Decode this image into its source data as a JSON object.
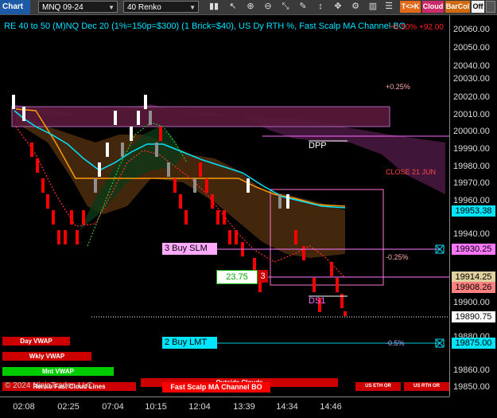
{
  "toolbar": {
    "chart_tab": "Chart",
    "instrument": "MNQ 09-24",
    "bar_type": "40 Renko",
    "tk_label": "T<>K",
    "cloud_label": "Cloud",
    "barcol_label": "BarCol",
    "off_label": "Off",
    "icons": [
      "bars-icon",
      "cursor-icon",
      "zoom-in-icon",
      "zoom-out-icon",
      "pointer-icon",
      "text-icon",
      "scale-icon",
      "pan-icon",
      "strategy-icon",
      "columns-icon",
      "list-icon",
      "share-icon"
    ]
  },
  "header": {
    "title": "RE 40 to 50 (M)NQ Dec 20 (1%=150p=$300) (1 Brick=$40), US Dy RTH %, Fast Scalp MA Channel BO",
    "top_right_value": "+0.50%  +92.00"
  },
  "annotations": {
    "pct_plus_025": "+0.25%",
    "dpp": "DPP",
    "close_label": "CLOSE 21 JUN",
    "pct_minus_025": "-0.25%",
    "pct_minus_05": "-0.5%",
    "ds1": "DS1",
    "buy_slm": "3 Buy SLM",
    "buy_lmt": "2 Buy LMT",
    "qty_value": "23.75",
    "qty_count": "3",
    "copyright": "© 2024 NinjaTrader, LLC",
    "fast_scalp": "Fast Scalp MA Channel BO",
    "outside_clouds": "Outside Clouds",
    "renko_label": "Renko Fast Cloud Lines"
  },
  "buttons": {
    "day_vwap": "Day VWAP",
    "wkly_vwap": "Wkly VWAP",
    "mnt_vwap": "Mnt VWAP",
    "us_eth_or": "US ETH OR",
    "us_rth_or": "US RTH OR"
  },
  "yaxis": {
    "labels": [
      "20060.00",
      "20050.00",
      "20040.00",
      "20030.00",
      "20020.00",
      "20010.00",
      "20000.00",
      "19990.00",
      "19980.00",
      "19970.00",
      "19960.00",
      "19940.00",
      "19900.00",
      "19880.00",
      "19860.00",
      "19850.00"
    ],
    "markers": {
      "price_top": "19953.38",
      "buy_slm": "19930.25",
      "gray": "19914.25",
      "last": "19908.26",
      "current": "19890.75",
      "buy_lmt": "19875.00"
    }
  },
  "xaxis": {
    "labels": [
      "02:08",
      "02:25",
      "07:04",
      "10:15",
      "12:04",
      "13:39",
      "14:34",
      "14:46"
    ]
  },
  "colors": {
    "accent_cyan": "#00e5ff",
    "magenta": "#ff66ff",
    "up_brick": "#ffffff",
    "down_brick": "#ff0000",
    "orange_line": "#ff9900",
    "vwap_red": "#cc0000",
    "vwap_green": "#00cc00"
  }
}
